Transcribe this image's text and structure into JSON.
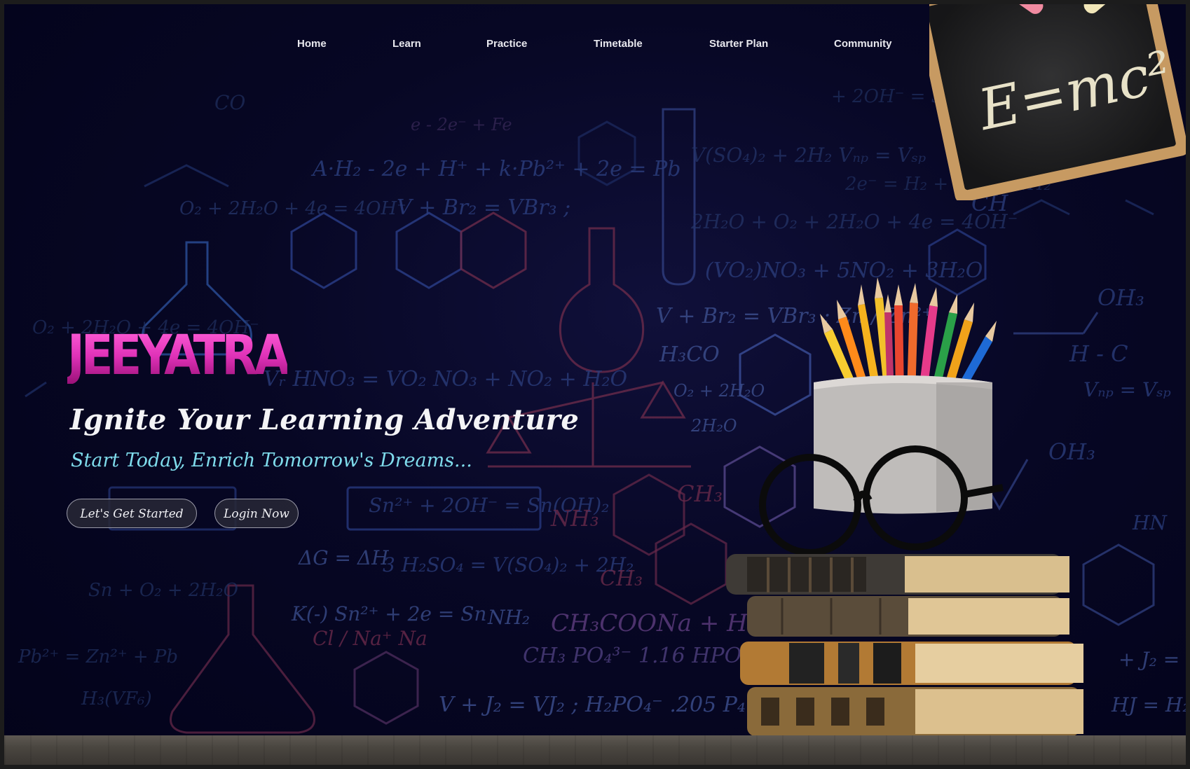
{
  "nav": {
    "items": [
      {
        "label": "Home"
      },
      {
        "label": "Learn"
      },
      {
        "label": "Practice"
      },
      {
        "label": "Timetable"
      },
      {
        "label": "Starter Plan"
      },
      {
        "label": "Community"
      }
    ]
  },
  "hero": {
    "brand": "JEEYATRA",
    "headline": "Ignite Your Learning Adventure",
    "subheadline": "Start Today, Enrich Tomorrow's Dreams...",
    "primary_button": "Let's Get Started",
    "secondary_button": "Login Now"
  },
  "chalkboard": {
    "formula": "E=mc²"
  },
  "colors": {
    "brand": "#e032b8",
    "subheadline": "#7fdcec",
    "background": "#070724"
  },
  "icons": [
    "pencil-cup-icon",
    "eyeglasses-icon",
    "book-stack-icon",
    "chalkboard-icon",
    "flask-icon",
    "hexagon-molecule-icon"
  ]
}
